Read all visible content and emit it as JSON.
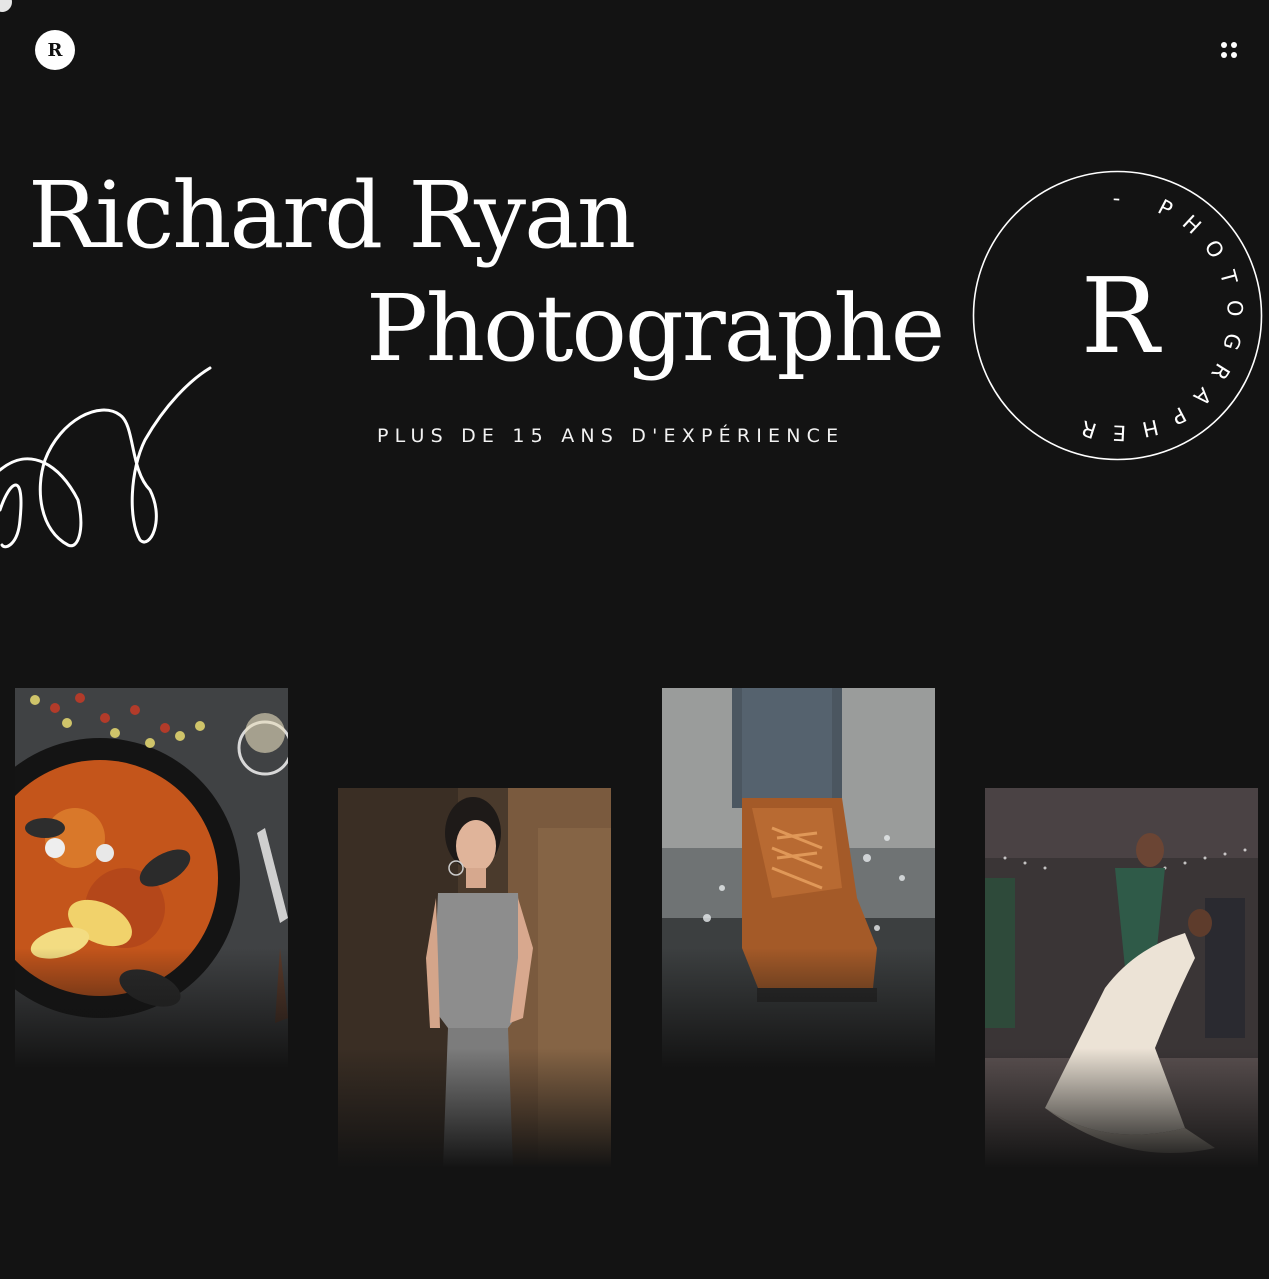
{
  "header": {
    "logo_letter": "R",
    "menu_icon": "grid-dots-icon"
  },
  "hero": {
    "name": "Richard Ryan",
    "role": "Photographe",
    "tagline": "PLUS DE 15 ANS D'EXPÉRIENCE"
  },
  "stamp": {
    "letter": "R",
    "ring_text": "PHOTOGRAPHER - PHOTOGRAPHER - ",
    "ring_visible": "- PHOTOGRAPHER"
  },
  "colors": {
    "background": "#131313",
    "text": "#ffffff"
  },
  "gallery": {
    "photos": [
      {
        "subject": "paella-dish-photo"
      },
      {
        "subject": "woman-portrait-photo"
      },
      {
        "subject": "boot-splash-photo"
      },
      {
        "subject": "wedding-dance-photo"
      }
    ]
  }
}
